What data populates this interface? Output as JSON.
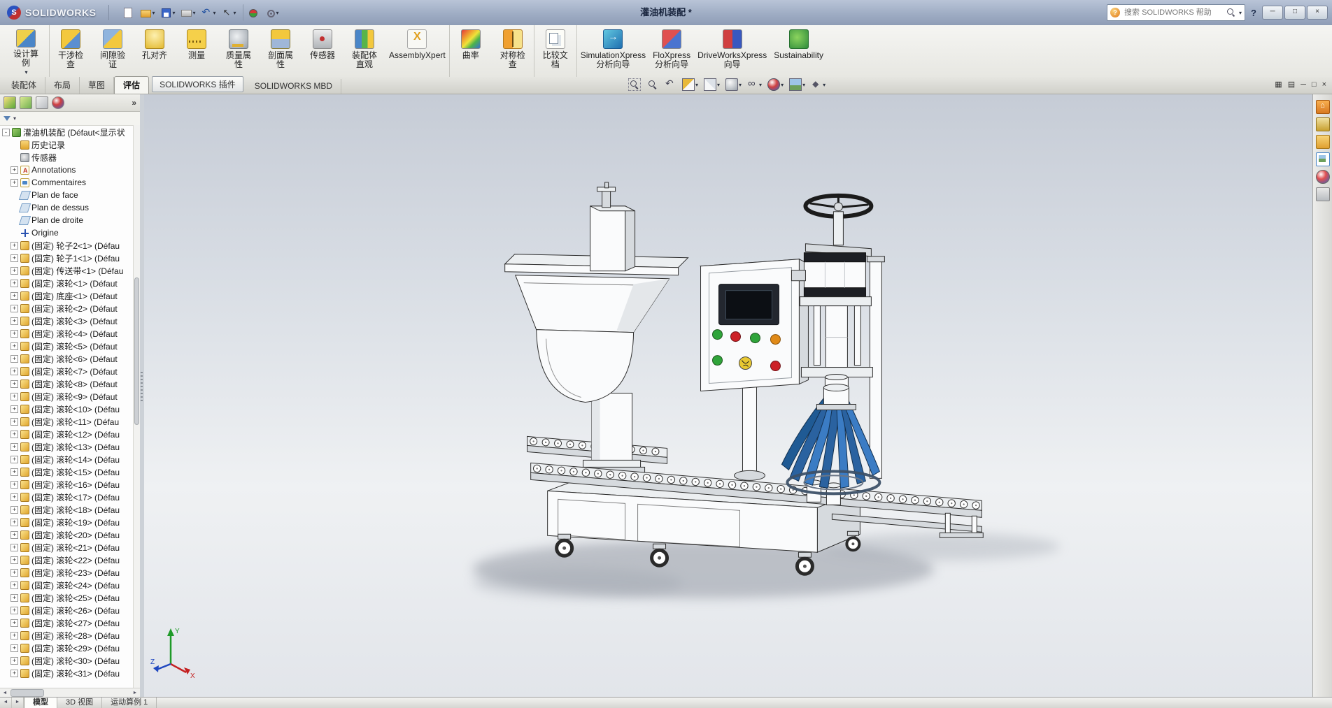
{
  "titlebar": {
    "brand": "SOLIDWORKS",
    "document_title": "灌油机装配 *",
    "search_placeholder": "搜索 SOLIDWORKS 帮助",
    "help_ball": "?",
    "help_label": "?",
    "window_buttons": [
      {
        "g": "─"
      },
      {
        "g": "□"
      },
      {
        "g": "×"
      }
    ]
  },
  "qat": {
    "items": [
      {
        "ic": "q-new"
      },
      {
        "ic": "q-open",
        "dd": "▾"
      },
      {
        "ic": "q-save",
        "dd": "▾"
      },
      {
        "ic": "q-print",
        "dd": "▾"
      },
      {
        "ic": "q-undo",
        "dd": "▾"
      },
      {
        "ic": "q-select",
        "dd": "▾"
      },
      {
        "ic": "q-rebuild",
        "cls": "gsepq"
      },
      {
        "ic": "q-options",
        "dd": "▾"
      }
    ]
  },
  "ribbon": {
    "design_study": {
      "label": "设计算\n例",
      "caret": "▾"
    },
    "buttons": [
      {
        "ic": "ic-interf",
        "label": "干涉检\n查"
      },
      {
        "ic": "ic-clear",
        "label": "间隙验\n证"
      },
      {
        "ic": "ic-hole",
        "label": "孔对齐"
      },
      {
        "ic": "ic-measure",
        "label": "测量"
      },
      {
        "ic": "ic-mass",
        "label": "质量属\n性"
      },
      {
        "ic": "ic-secprop",
        "label": "剖面属\n性"
      },
      {
        "ic": "ic-sensor",
        "label": "传感器"
      },
      {
        "ic": "ic-visual",
        "label": "装配体\n直观"
      },
      {
        "ic": "ic-axpert",
        "label": "AssemblyXpert"
      },
      {
        "ic": "ic-curv",
        "label": "曲率",
        "cls": "gsep"
      },
      {
        "ic": "ic-symm",
        "label": "对称检\n查"
      },
      {
        "ic": "ic-compare",
        "label": "比较文\n档",
        "cls": "gsep"
      },
      {
        "ic": "ic-simx",
        "label": "SimulationXpress\n分析向导",
        "cls": "gsep"
      },
      {
        "ic": "ic-flox",
        "label": "FloXpress\n分析向导"
      },
      {
        "ic": "ic-dwx",
        "label": "DriveWorksXpress\n向导"
      },
      {
        "ic": "ic-sust",
        "label": "Sustainability"
      }
    ]
  },
  "command_tabs": {
    "items": [
      {
        "label": "装配体"
      },
      {
        "label": "布局"
      },
      {
        "label": "草图"
      },
      {
        "label": "评估",
        "cls": "active"
      },
      {
        "label": "SOLIDWORKS 插件",
        "cls": "boxed"
      },
      {
        "label": "SOLIDWORKS MBD"
      }
    ]
  },
  "headsup": {
    "items": [
      {
        "ic": "h-zoomfit"
      },
      {
        "ic": "h-zoomarea"
      },
      {
        "ic": "h-prev"
      },
      {
        "ic": "h-section",
        "dd": "▾"
      },
      {
        "ic": "h-orient",
        "dd": "▾"
      },
      {
        "ic": "h-display",
        "dd": "▾"
      },
      {
        "ic": "h-hide",
        "dd": "▾"
      },
      {
        "ic": "h-appear",
        "dd": "▾"
      },
      {
        "ic": "h-scene",
        "dd": "▾"
      },
      {
        "ic": "h-settings",
        "dd": "▾"
      }
    ]
  },
  "docbar": {
    "buttons": [
      {
        "g": "▦"
      },
      {
        "g": "▤"
      },
      {
        "g": "─"
      },
      {
        "g": "□"
      },
      {
        "g": "×"
      }
    ]
  },
  "panel": {
    "chevron": "»",
    "filter_caret": "▾",
    "hscroll_left": "◄",
    "hscroll_right": "►",
    "tabs": [
      {
        "ic": "pt-feature"
      },
      {
        "ic": "pt-property"
      },
      {
        "ic": "pt-config"
      },
      {
        "ic": "pt-display"
      }
    ]
  },
  "tree": {
    "items": [
      {
        "e": "-",
        "ic": "ti-asm",
        "t": "灌油机装配 (Défaut<显示状"
      },
      {
        "ic": "ti-hist",
        "t": "历史记录"
      },
      {
        "ic": "ti-sensor",
        "t": "传感器"
      },
      {
        "e": "+",
        "ic": "ti-ann",
        "t": "Annotations"
      },
      {
        "e": "+",
        "ic": "ti-comm",
        "t": "Commentaires"
      },
      {
        "ic": "ti-plane",
        "t": "Plan de face"
      },
      {
        "ic": "ti-plane",
        "t": "Plan de dessus"
      },
      {
        "ic": "ti-plane",
        "t": "Plan de droite"
      },
      {
        "ic": "ti-origin",
        "t": "Origine"
      },
      {
        "e": "+",
        "ic": "ti-part",
        "t": "(固定) 轮子2<1> (Défau"
      },
      {
        "e": "+",
        "ic": "ti-part",
        "t": "(固定) 轮子1<1> (Défau"
      },
      {
        "e": "+",
        "ic": "ti-part",
        "t": "(固定) 传送带<1> (Défau"
      },
      {
        "e": "+",
        "ic": "ti-part",
        "t": "(固定) 滚轮<1> (Défaut"
      },
      {
        "e": "+",
        "ic": "ti-part",
        "t": "(固定) 底座<1> (Défaut"
      },
      {
        "e": "+",
        "ic": "ti-part",
        "t": "(固定) 滚轮<2> (Défaut"
      },
      {
        "e": "+",
        "ic": "ti-part",
        "t": "(固定) 滚轮<3> (Défaut"
      },
      {
        "e": "+",
        "ic": "ti-part",
        "t": "(固定) 滚轮<4> (Défaut"
      },
      {
        "e": "+",
        "ic": "ti-part",
        "t": "(固定) 滚轮<5> (Défaut"
      },
      {
        "e": "+",
        "ic": "ti-part",
        "t": "(固定) 滚轮<6> (Défaut"
      },
      {
        "e": "+",
        "ic": "ti-part",
        "t": "(固定) 滚轮<7> (Défaut"
      },
      {
        "e": "+",
        "ic": "ti-part",
        "t": "(固定) 滚轮<8> (Défaut"
      },
      {
        "e": "+",
        "ic": "ti-part",
        "t": "(固定) 滚轮<9> (Défaut"
      },
      {
        "e": "+",
        "ic": "ti-part",
        "t": "(固定) 滚轮<10> (Défau"
      },
      {
        "e": "+",
        "ic": "ti-part",
        "t": "(固定) 滚轮<11> (Défau"
      },
      {
        "e": "+",
        "ic": "ti-part",
        "t": "(固定) 滚轮<12> (Défau"
      },
      {
        "e": "+",
        "ic": "ti-part",
        "t": "(固定) 滚轮<13> (Défau"
      },
      {
        "e": "+",
        "ic": "ti-part",
        "t": "(固定) 滚轮<14> (Défau"
      },
      {
        "e": "+",
        "ic": "ti-part",
        "t": "(固定) 滚轮<15> (Défau"
      },
      {
        "e": "+",
        "ic": "ti-part",
        "t": "(固定) 滚轮<16> (Défau"
      },
      {
        "e": "+",
        "ic": "ti-part",
        "t": "(固定) 滚轮<17> (Défau"
      },
      {
        "e": "+",
        "ic": "ti-part",
        "t": "(固定) 滚轮<18> (Défau"
      },
      {
        "e": "+",
        "ic": "ti-part",
        "t": "(固定) 滚轮<19> (Défau"
      },
      {
        "e": "+",
        "ic": "ti-part",
        "t": "(固定) 滚轮<20> (Défau"
      },
      {
        "e": "+",
        "ic": "ti-part",
        "t": "(固定) 滚轮<21> (Défau"
      },
      {
        "e": "+",
        "ic": "ti-part",
        "t": "(固定) 滚轮<22> (Défau"
      },
      {
        "e": "+",
        "ic": "ti-part",
        "t": "(固定) 滚轮<23> (Défau"
      },
      {
        "e": "+",
        "ic": "ti-part",
        "t": "(固定) 滚轮<24> (Défau"
      },
      {
        "e": "+",
        "ic": "ti-part",
        "t": "(固定) 滚轮<25> (Défau"
      },
      {
        "e": "+",
        "ic": "ti-part",
        "t": "(固定) 滚轮<26> (Défau"
      },
      {
        "e": "+",
        "ic": "ti-part",
        "t": "(固定) 滚轮<27> (Défau"
      },
      {
        "e": "+",
        "ic": "ti-part",
        "t": "(固定) 滚轮<28> (Défau"
      },
      {
        "e": "+",
        "ic": "ti-part",
        "t": "(固定) 滚轮<29> (Défau"
      },
      {
        "e": "+",
        "ic": "ti-part",
        "t": "(固定) 滚轮<30> (Défau"
      },
      {
        "e": "+",
        "ic": "ti-part",
        "t": "(固定) 滚轮<31> (Défau"
      }
    ]
  },
  "taskpane": {
    "items": [
      {
        "ic": "tp-home"
      },
      {
        "ic": "tp-lib"
      },
      {
        "ic": "tp-files"
      },
      {
        "ic": "tp-palette"
      },
      {
        "ic": "tp-appear"
      },
      {
        "ic": "tp-props"
      }
    ]
  },
  "statusbar": {
    "arrows": [
      {
        "g": "◄"
      },
      {
        "g": "►"
      }
    ],
    "tabs": [
      {
        "label": "模型",
        "cls": "active"
      },
      {
        "label": "3D 视图"
      },
      {
        "label": "运动算例 1"
      }
    ]
  },
  "viewport": {
    "triad": {
      "x": "X",
      "y": "Y",
      "z": "Z"
    }
  }
}
